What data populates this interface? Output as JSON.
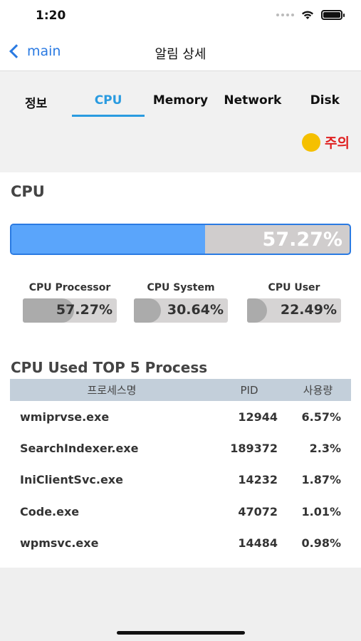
{
  "status_bar": {
    "time": "1:20"
  },
  "nav": {
    "back_label": "main",
    "title": "알림 상세"
  },
  "tabs": [
    {
      "label": "정보",
      "active": false
    },
    {
      "label": "CPU",
      "active": true
    },
    {
      "label": "Memory",
      "active": false
    },
    {
      "label": "Network",
      "active": false
    },
    {
      "label": "Disk",
      "active": false
    }
  ],
  "alert": {
    "label": "주의",
    "color": "#f5c000"
  },
  "cpu": {
    "section_title": "CPU",
    "total_percent": 57.27,
    "total_label": "57.27%",
    "metrics": [
      {
        "label": "CPU Processor",
        "percent": 57.27,
        "value": "57.27%"
      },
      {
        "label": "CPU System",
        "percent": 30.64,
        "value": "30.64%"
      },
      {
        "label": "CPU User",
        "percent": 22.49,
        "value": "22.49%"
      }
    ]
  },
  "top_processes": {
    "title": "CPU Used TOP 5 Process",
    "headers": {
      "name": "프로세스명",
      "pid": "PID",
      "usage": "사용량"
    },
    "rows": [
      {
        "name": "wmiprvse.exe",
        "pid": "12944",
        "usage": "6.57%"
      },
      {
        "name": "SearchIndexer.exe",
        "pid": "189372",
        "usage": "2.3%"
      },
      {
        "name": "IniClientSvc.exe",
        "pid": "14232",
        "usage": "1.87%"
      },
      {
        "name": "Code.exe",
        "pid": "47072",
        "usage": "1.01%"
      },
      {
        "name": "wpmsvc.exe",
        "pid": "14484",
        "usage": "0.98%"
      }
    ]
  },
  "colors": {
    "accent": "#2a7ae2",
    "tab_active": "#2a9be0",
    "bar_fill": "#5aa5fb",
    "alert_text": "#e02020"
  }
}
